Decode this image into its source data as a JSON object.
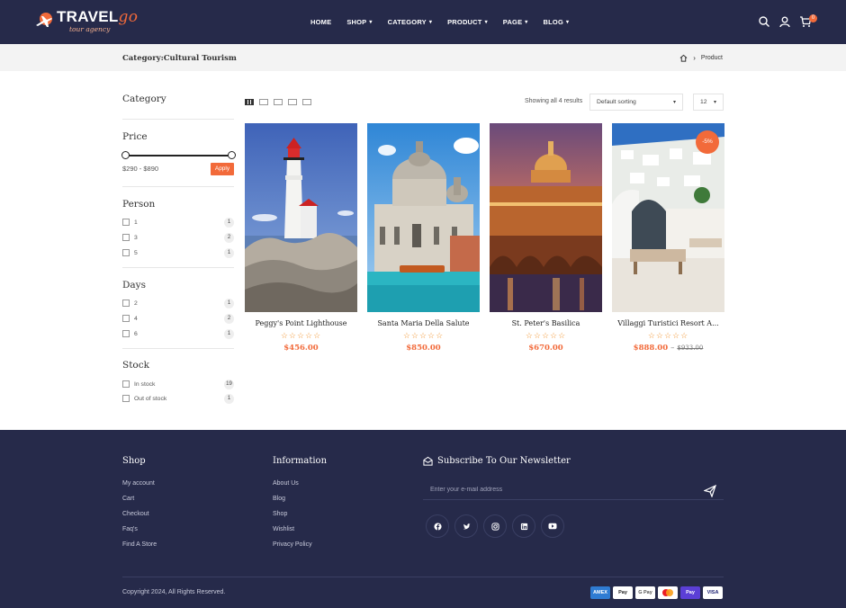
{
  "header": {
    "logo_title": "TRAVEL",
    "logo_accent": "go",
    "logo_sub": "tour agency",
    "nav": [
      {
        "label": "HOME",
        "has_dropdown": false
      },
      {
        "label": "SHOP",
        "has_dropdown": true
      },
      {
        "label": "CATEGORY",
        "has_dropdown": true
      },
      {
        "label": "PRODUCT",
        "has_dropdown": true
      },
      {
        "label": "PAGE",
        "has_dropdown": true
      },
      {
        "label": "BLOG",
        "has_dropdown": true
      }
    ],
    "cart_count": "0",
    "icons": [
      "search-icon",
      "user-icon",
      "cart-icon"
    ]
  },
  "breadcrumb": {
    "category_title": "Category:Cultural Tourism",
    "current": "Product"
  },
  "sidebar": {
    "category_heading": "Category",
    "price_heading": "Price",
    "price_range": "$290 - $890",
    "apply_label": "Apply",
    "person_heading": "Person",
    "person": [
      {
        "label": "1",
        "count": "1"
      },
      {
        "label": "3",
        "count": "2"
      },
      {
        "label": "5",
        "count": "1"
      }
    ],
    "days_heading": "Days",
    "days": [
      {
        "label": "2",
        "count": "1"
      },
      {
        "label": "4",
        "count": "2"
      },
      {
        "label": "6",
        "count": "1"
      }
    ],
    "stock_heading": "Stock",
    "stock": [
      {
        "label": "In stock",
        "count": "19"
      },
      {
        "label": "Out of stock",
        "count": "1"
      }
    ]
  },
  "toolbar": {
    "showing": "Showing all 4 results",
    "sort_value": "Default sorting",
    "per_page": "12"
  },
  "products": [
    {
      "name": "Peggy's Point Lighthouse",
      "price": "$456.00",
      "old_price": "",
      "sale": ""
    },
    {
      "name": "Santa Maria Della Salute",
      "price": "$850.00",
      "old_price": "",
      "sale": ""
    },
    {
      "name": "St. Peter's Basilica",
      "price": "$670.00",
      "old_price": "",
      "sale": ""
    },
    {
      "name": "Villaggi Turistici Resort A...",
      "price": "$888.00",
      "old_price": "$933.00",
      "sale": "-5%"
    }
  ],
  "footer": {
    "shop_heading": "Shop",
    "shop_links": [
      "My account",
      "Cart",
      "Checkout",
      "Faq's",
      "Find A Store"
    ],
    "info_heading": "Information",
    "info_links": [
      "About Us",
      "Blog",
      "Shop",
      "Wishlist",
      "Privacy Policy"
    ],
    "newsletter_heading": "Subscribe To Our Newsletter",
    "newsletter_placeholder": "Enter your e-mail address",
    "socials": [
      "facebook-icon",
      "twitter-icon",
      "instagram-icon",
      "linkedin-icon",
      "youtube-icon"
    ],
    "copyright": "Copyright 2024, All Rights Reserved.",
    "payments": [
      "AMEX",
      "Pay",
      "G Pay",
      "MC",
      "Pay",
      "VISA"
    ]
  },
  "colors": {
    "accent": "#f26a3a",
    "navy": "#262a4a"
  }
}
